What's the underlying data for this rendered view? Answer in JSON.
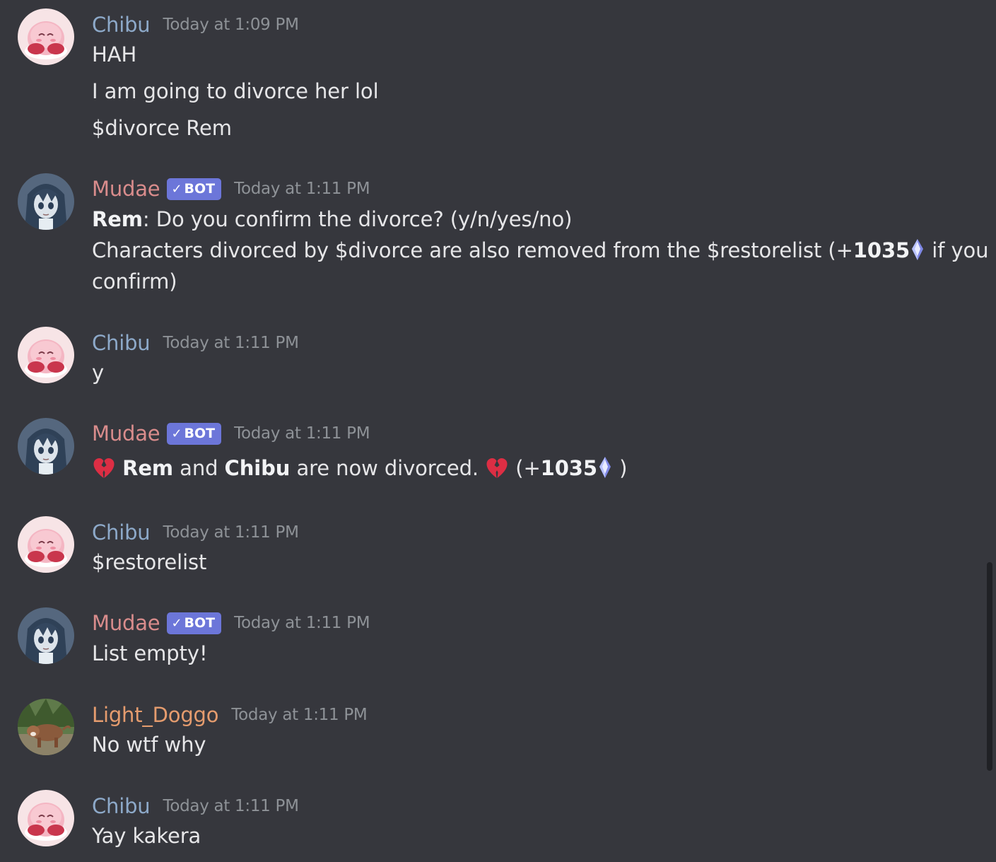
{
  "messages": [
    {
      "author": "Chibu",
      "timestamp": "Today at 1:09 PM",
      "lines": [
        "HAH",
        "I am going to divorce her lol",
        "$divorce Rem"
      ]
    },
    {
      "author": "Mudae",
      "bot_tag": "BOT",
      "timestamp": "Today at 1:11 PM",
      "confirm": {
        "name": "Rem",
        "question": ": Do you confirm the divorce? (y/n/yes/no)",
        "line2_pre": "Characters divorced by $divorce are also removed from the $restorelist (+",
        "amount": "1035",
        "line2_post": " if you",
        "line3": "confirm)"
      }
    },
    {
      "author": "Chibu",
      "timestamp": "Today at 1:11 PM",
      "lines": [
        "y"
      ]
    },
    {
      "author": "Mudae",
      "bot_tag": "BOT",
      "timestamp": "Today at 1:11 PM",
      "divorced": {
        "name1": "Rem",
        "and": " and ",
        "name2": "Chibu",
        "text": " are now divorced. ",
        "open": " (+",
        "amount": "1035",
        "close": " )"
      }
    },
    {
      "author": "Chibu",
      "timestamp": "Today at 1:11 PM",
      "lines": [
        "$restorelist"
      ]
    },
    {
      "author": "Mudae",
      "bot_tag": "BOT",
      "timestamp": "Today at 1:11 PM",
      "lines": [
        "List empty!"
      ]
    },
    {
      "author": "Light_Doggo",
      "timestamp": "Today at 1:11 PM",
      "lines": [
        "No wtf why"
      ]
    },
    {
      "author": "Chibu",
      "timestamp": "Today at 1:11 PM",
      "lines": [
        "Yay kakera"
      ]
    }
  ],
  "icons": {
    "bot_check": "✓",
    "broken_heart": "broken-heart-icon",
    "kakera": "kakera-crystal-icon"
  },
  "colors": {
    "background": "#36373d",
    "chibu": "#8da9c9",
    "mudae": "#d98c8c",
    "light_doggo": "#e59c6e",
    "bot_tag": "#6c76d9",
    "timestamp": "#8e9297"
  }
}
